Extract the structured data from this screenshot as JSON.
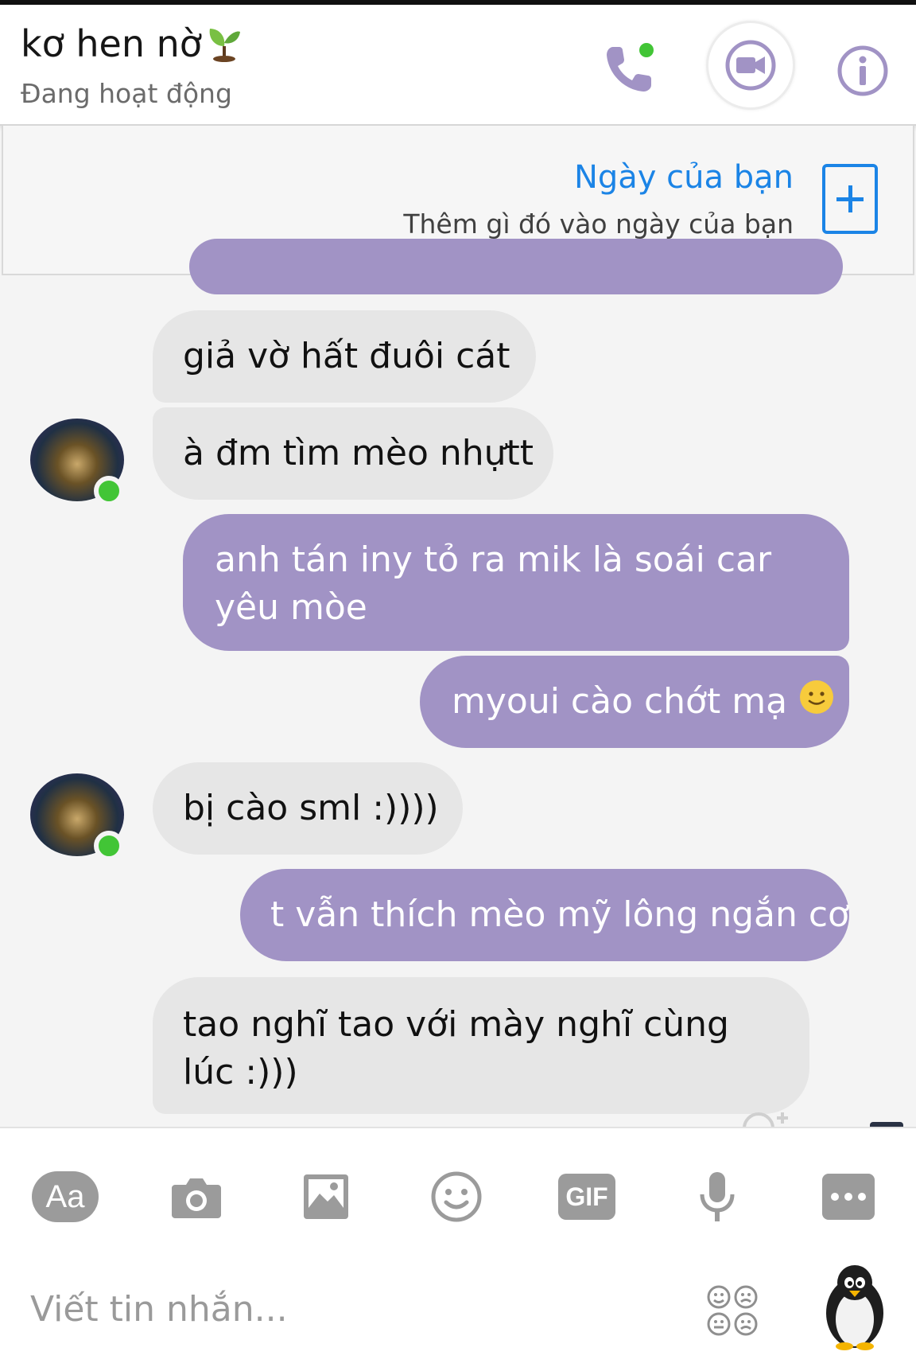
{
  "header": {
    "contact_name": "kơ hen nờ",
    "status": "Đang hoạt động",
    "icons": [
      "phone-call-icon",
      "video-call-icon",
      "info-icon"
    ],
    "accent_color": "#a193c5"
  },
  "day_banner": {
    "title": "Ngày của bạn",
    "subtitle": "Thêm gì đó vào ngày của bạn",
    "accent_color": "#1b84e6"
  },
  "messages": [
    {
      "direction": "incoming",
      "text": "giả vờ hất đuôi cát"
    },
    {
      "direction": "incoming",
      "text": "à đm tìm mèo nhựtt"
    },
    {
      "direction": "outgoing",
      "line1": "anh tán iny tỏ ra mik là soái car",
      "line2": "yêu mòe"
    },
    {
      "direction": "outgoing",
      "text": "myoui cào chớt mạ",
      "emoji": "slightly-smiling-face"
    },
    {
      "direction": "incoming",
      "text": "bị cào sml :))))"
    },
    {
      "direction": "outgoing",
      "text": "t vẫn thích mèo mỹ lông ngắn cơ"
    },
    {
      "direction": "incoming",
      "line1": "tao nghĩ tao với mày nghĩ cùng",
      "line2": "lúc :)))"
    }
  ],
  "composer": {
    "aa_label": "Aa",
    "gif_label": "GIF",
    "placeholder": "Viết tin nhắn...",
    "tools": [
      "text-style-button",
      "camera-icon",
      "image-icon",
      "emoji-icon",
      "gif-button",
      "microphone-icon",
      "more-icon"
    ],
    "sticker_icon": "sticker-faces-icon",
    "quick_reaction": "penguin-icon"
  },
  "colors": {
    "outgoing_bubble": "#a193c5",
    "incoming_bubble": "#e6e6e6",
    "online_dot": "#42c536"
  }
}
